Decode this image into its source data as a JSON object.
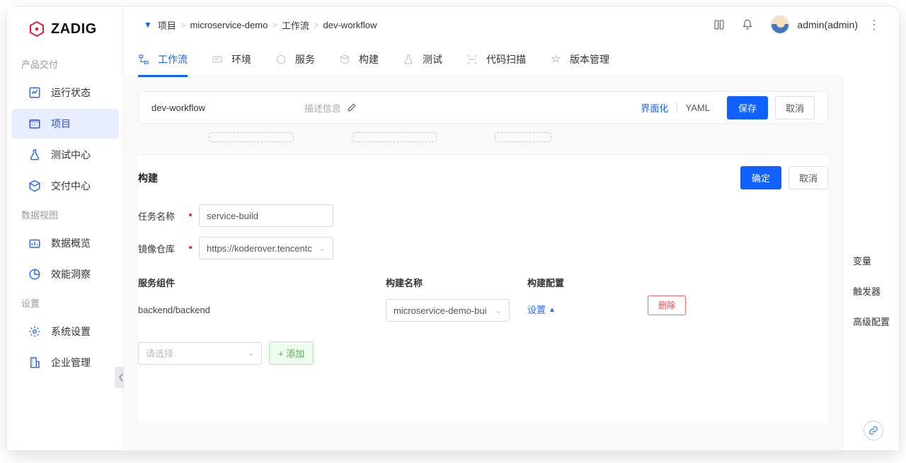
{
  "logo": "ZADIG",
  "sidebar": {
    "groups": [
      {
        "label": "产品交付",
        "items": [
          {
            "label": "运行状态",
            "icon": "chart"
          },
          {
            "label": "项目",
            "icon": "project",
            "active": true
          },
          {
            "label": "测试中心",
            "icon": "flask"
          },
          {
            "label": "交付中心",
            "icon": "package"
          }
        ]
      },
      {
        "label": "数据视图",
        "items": [
          {
            "label": "数据概览",
            "icon": "bars"
          },
          {
            "label": "效能洞察",
            "icon": "pie"
          }
        ]
      },
      {
        "label": "设置",
        "items": [
          {
            "label": "系统设置",
            "icon": "gear"
          },
          {
            "label": "企业管理",
            "icon": "building"
          }
        ]
      }
    ]
  },
  "breadcrumb": [
    "项目",
    "microservice-demo",
    "工作流",
    "dev-workflow"
  ],
  "user": "admin(admin)",
  "tabs": [
    {
      "label": "工作流",
      "active": true
    },
    {
      "label": "环境"
    },
    {
      "label": "服务"
    },
    {
      "label": "构建"
    },
    {
      "label": "测试"
    },
    {
      "label": "代码扫描"
    },
    {
      "label": "版本管理"
    }
  ],
  "header": {
    "name": "dev-workflow",
    "desc_label": "描述信息",
    "mode_ui": "界面化",
    "mode_yaml": "YAML",
    "save": "保存",
    "cancel": "取消"
  },
  "panel": {
    "title": "构建",
    "confirm": "确定",
    "cancel": "取消",
    "task_label": "任务名称",
    "task_value": "service-build",
    "repo_label": "镜像仓库",
    "repo_value": "https://koderover.tencentc",
    "col_service": "服务组件",
    "col_build": "构建名称",
    "col_config": "构建配置",
    "row_service": "backend/backend",
    "row_build": "microservice-demo-bui",
    "row_config": "设置",
    "row_delete": "删除",
    "add_placeholder": "请选择",
    "add_button": "+ 添加"
  },
  "rightrail": [
    "变量",
    "触发器",
    "高级配置"
  ]
}
